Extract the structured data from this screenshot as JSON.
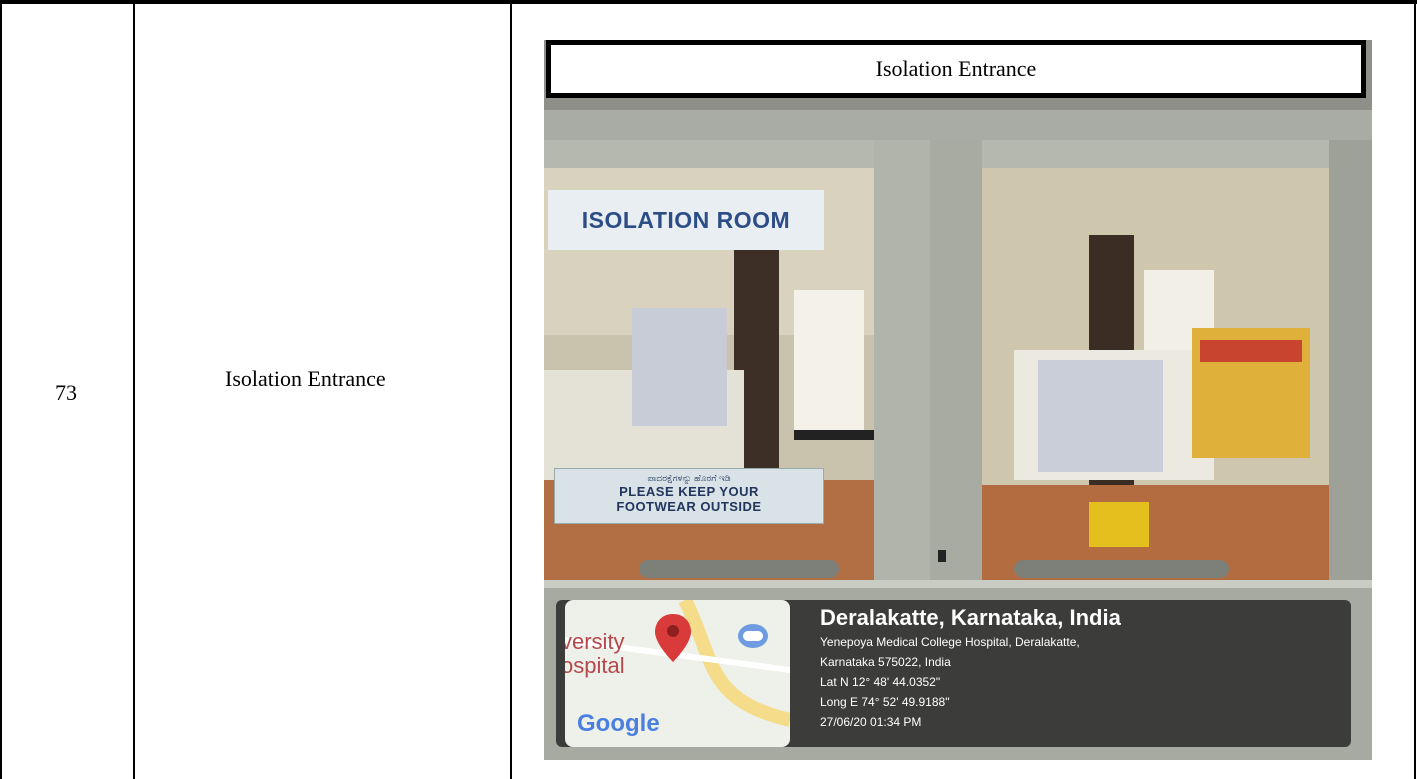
{
  "row": {
    "number": "73",
    "description": "Isolation Entrance"
  },
  "photo": {
    "caption": "Isolation Entrance",
    "sign_isolation": "ISOLATION ROOM",
    "sign_footwear_kannada": "ಪಾದರಕ್ಷೆಗಳನ್ನು ಹೊರಗೆ ಇಡಿ",
    "sign_footwear_line1": "PLEASE KEEP YOUR",
    "sign_footwear_line2": "FOOTWEAR OUTSIDE",
    "map": {
      "label_line1": "versity",
      "label_line2": "ospital",
      "brand": "Google",
      "pin_color": "#d93a3a"
    },
    "gps": {
      "title": "Deralakatte, Karnataka, India",
      "address_line1": "Yenepoya Medical College Hospital, Deralakatte,",
      "address_line2": "Karnataka 575022, India",
      "lat": "Lat N 12° 48' 44.0352\"",
      "long": "Long E 74° 52' 49.9188\"",
      "timestamp": "27/06/20 01:34 PM"
    }
  }
}
